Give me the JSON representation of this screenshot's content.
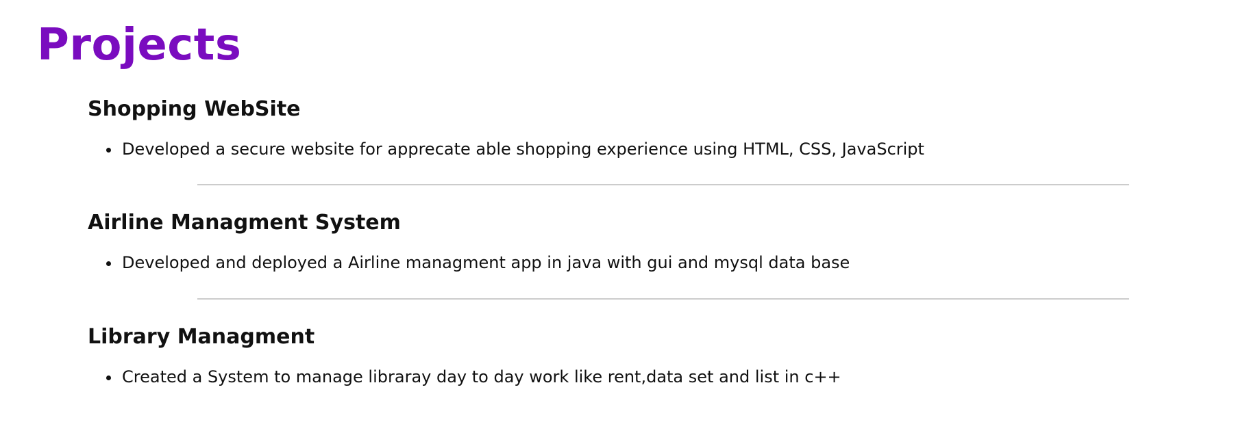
{
  "page": {
    "title": "Projects"
  },
  "projects": [
    {
      "title": "Shopping WebSite",
      "items": [
        "Developed a secure website for apprecate able shopping experience using HTML, CSS, JavaScript"
      ]
    },
    {
      "title": "Airline Managment System",
      "items": [
        "Developed and deployed a Airline managment app in java with gui and mysql data base"
      ]
    },
    {
      "title": "Library Managment",
      "items": [
        "Created a System to manage libraray day to day work like rent,data set and list in c++"
      ]
    }
  ],
  "colors": {
    "title": "#7a0cbf",
    "text": "#111111",
    "divider": "#cccccc"
  }
}
